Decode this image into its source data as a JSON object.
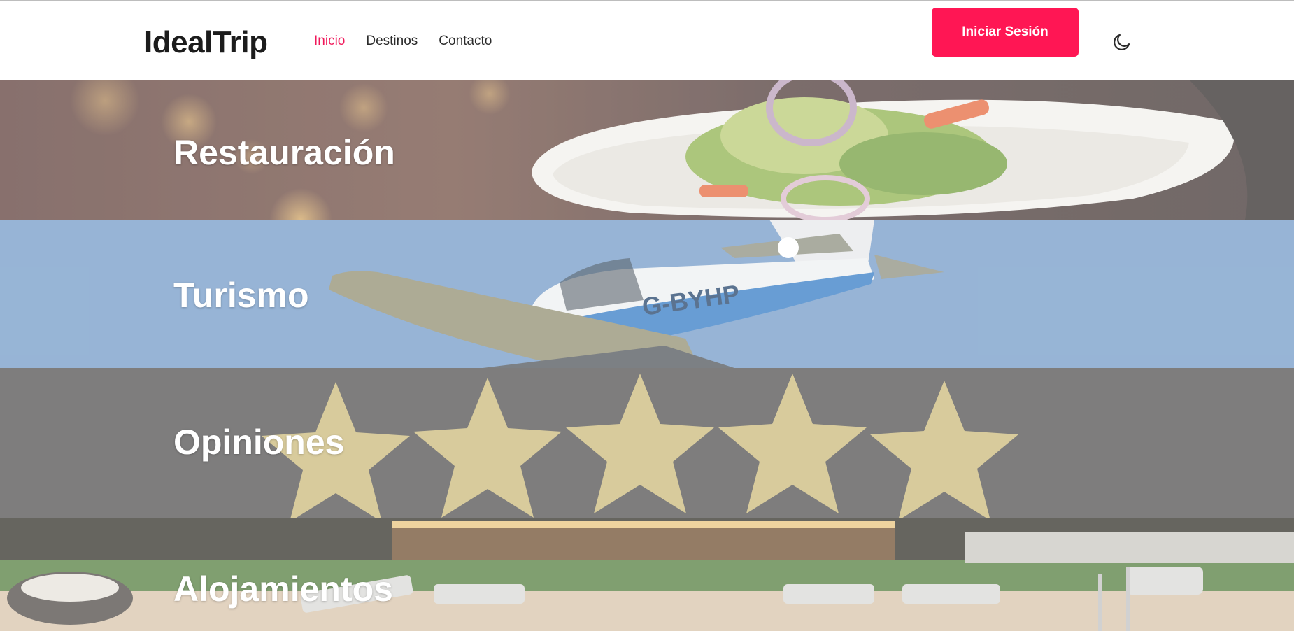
{
  "header": {
    "brand": "IdealTrip",
    "nav": [
      {
        "label": "Inicio",
        "active": true
      },
      {
        "label": "Destinos",
        "active": false
      },
      {
        "label": "Contacto",
        "active": false
      }
    ],
    "login_label": "Iniciar Sesión",
    "theme_icon": "moon-icon"
  },
  "sections": [
    {
      "label": "Restauración",
      "image": "salad-plate-photo"
    },
    {
      "label": "Turismo",
      "image": "airplane-photo"
    },
    {
      "label": "Opiniones",
      "image": "five-stars-photo"
    },
    {
      "label": "Alojamientos",
      "image": "resort-pool-photo"
    }
  ],
  "colors": {
    "accent": "#ff1654",
    "active_link": "#f0185a",
    "brand_text": "#1c1c1c"
  }
}
